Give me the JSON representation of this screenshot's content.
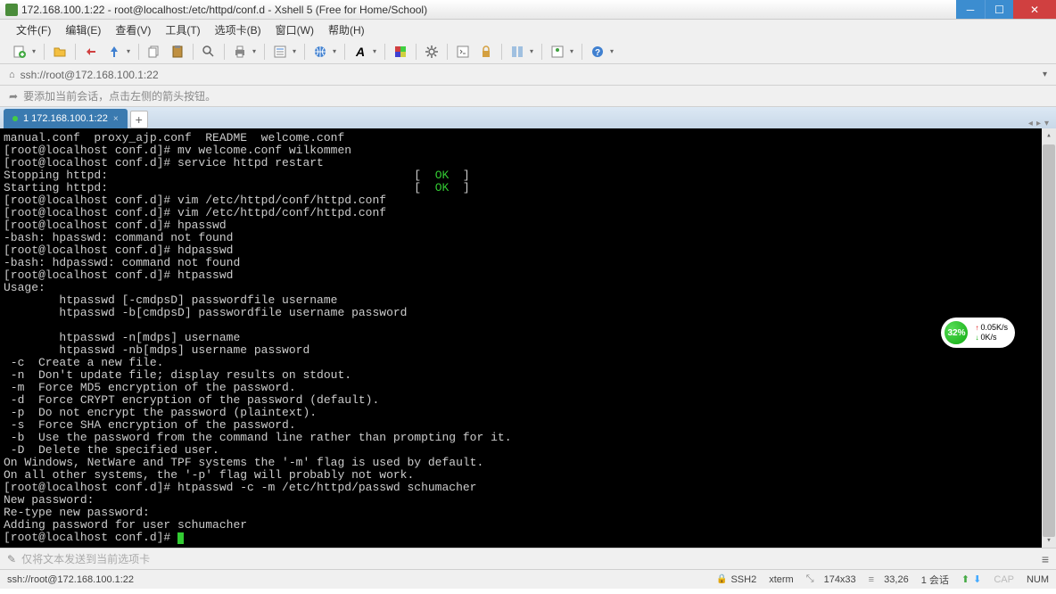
{
  "window": {
    "title": "172.168.100.1:22 - root@localhost:/etc/httpd/conf.d - Xshell 5 (Free for Home/School)"
  },
  "menu": [
    "文件(F)",
    "编辑(E)",
    "查看(V)",
    "工具(T)",
    "选项卡(B)",
    "窗口(W)",
    "帮助(H)"
  ],
  "address": {
    "url": "ssh://root@172.168.100.1:22"
  },
  "hint": "要添加当前会话，点击左侧的箭头按钮。",
  "tab": {
    "label": "1 172.168.100.1:22"
  },
  "terminal_lines": [
    {
      "t": "manual.conf  proxy_ajp.conf  README  welcome.conf"
    },
    {
      "t": "[root@localhost conf.d]# mv welcome.conf wilkommen"
    },
    {
      "t": "[root@localhost conf.d]# service httpd restart"
    },
    {
      "t": "Stopping httpd:                                            [  ",
      "ok": "OK",
      "t2": "  ]"
    },
    {
      "t": "Starting httpd:                                            [  ",
      "ok": "OK",
      "t2": "  ]"
    },
    {
      "t": "[root@localhost conf.d]# vim /etc/httpd/conf/httpd.conf"
    },
    {
      "t": "[root@localhost conf.d]# vim /etc/httpd/conf/httpd.conf"
    },
    {
      "t": "[root@localhost conf.d]# hpasswd"
    },
    {
      "t": "-bash: hpasswd: command not found"
    },
    {
      "t": "[root@localhost conf.d]# hdpasswd"
    },
    {
      "t": "-bash: hdpasswd: command not found"
    },
    {
      "t": "[root@localhost conf.d]# htpasswd"
    },
    {
      "t": "Usage:"
    },
    {
      "t": "        htpasswd [-cmdpsD] passwordfile username"
    },
    {
      "t": "        htpasswd -b[cmdpsD] passwordfile username password"
    },
    {
      "t": ""
    },
    {
      "t": "        htpasswd -n[mdps] username"
    },
    {
      "t": "        htpasswd -nb[mdps] username password"
    },
    {
      "t": " -c  Create a new file."
    },
    {
      "t": " -n  Don't update file; display results on stdout."
    },
    {
      "t": " -m  Force MD5 encryption of the password."
    },
    {
      "t": " -d  Force CRYPT encryption of the password (default)."
    },
    {
      "t": " -p  Do not encrypt the password (plaintext)."
    },
    {
      "t": " -s  Force SHA encryption of the password."
    },
    {
      "t": " -b  Use the password from the command line rather than prompting for it."
    },
    {
      "t": " -D  Delete the specified user."
    },
    {
      "t": "On Windows, NetWare and TPF systems the '-m' flag is used by default."
    },
    {
      "t": "On all other systems, the '-p' flag will probably not work."
    },
    {
      "t": "[root@localhost conf.d]# htpasswd -c -m /etc/httpd/passwd schumacher"
    },
    {
      "t": "New password: "
    },
    {
      "t": "Re-type new password: "
    },
    {
      "t": "Adding password for user schumacher"
    },
    {
      "t": "[root@localhost conf.d]# ",
      "cursor": true
    }
  ],
  "footer_input": {
    "placeholder": "仅将文本发送到当前选项卡"
  },
  "status": {
    "left": "ssh://root@172.168.100.1:22",
    "ssh": "SSH2",
    "term": "xterm",
    "size": "174x33",
    "pos": "33,26",
    "sessions": "1 会话",
    "cap": "CAP",
    "num": "NUM"
  },
  "widget": {
    "percent": "32%",
    "up": "0.05K/s",
    "down": "0K/s"
  }
}
